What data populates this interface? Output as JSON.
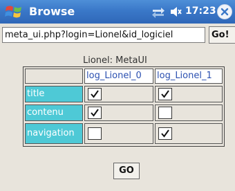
{
  "titlebar": {
    "app_title": "Browse",
    "clock": "17:23",
    "start_icon": "windows-flag-icon",
    "connectivity_icon": "connectivity-icon",
    "volume_icon": "speaker-icon",
    "close_icon": "close-icon"
  },
  "address": {
    "value": "meta_ui.php?login=Lionel&id_logiciel",
    "go_label": "Go!"
  },
  "form": {
    "heading": "Lionel: MetaUI",
    "columns": [
      "log_Lionel_0",
      "log_Lionel_1"
    ],
    "rows": [
      {
        "label": "title",
        "checks": [
          true,
          true
        ]
      },
      {
        "label": "contenu",
        "checks": [
          true,
          false
        ]
      },
      {
        "label": "navigation",
        "checks": [
          false,
          true
        ]
      }
    ],
    "submit_label": "GO"
  },
  "colors": {
    "titlebar": "#3a78c8",
    "row_label_bg": "#4ec9d6",
    "column_header_text": "#2a4fb0",
    "background": "#e8e4dc"
  }
}
